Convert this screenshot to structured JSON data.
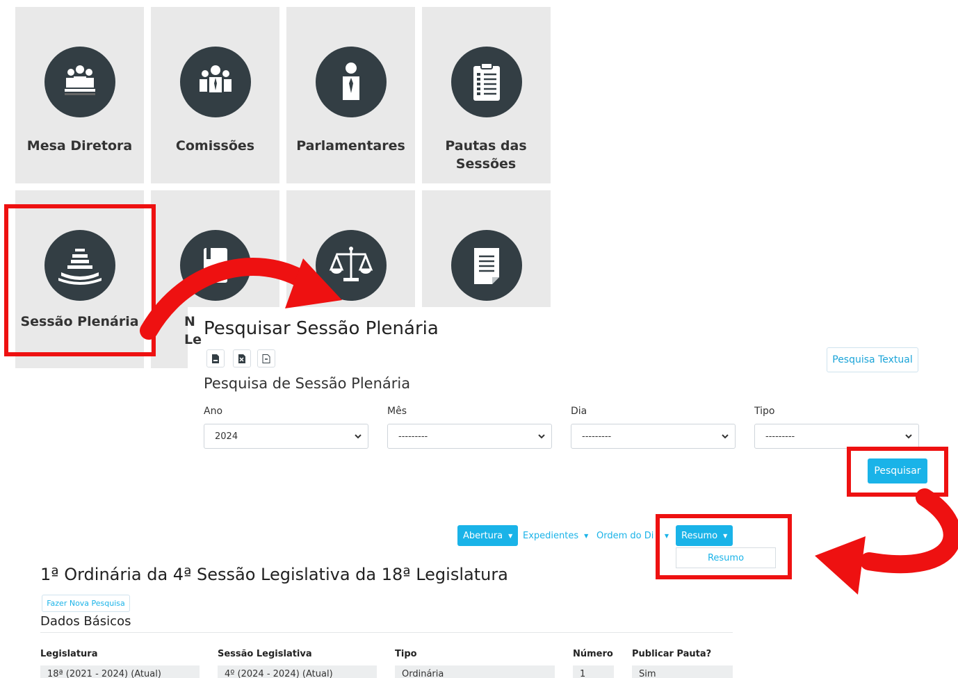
{
  "tiles": {
    "row1": [
      {
        "label": "Mesa Diretora",
        "icon": "board-meeting-icon"
      },
      {
        "label": "Comissões",
        "icon": "group-people-icon"
      },
      {
        "label": "Parlamentares",
        "icon": "person-icon"
      },
      {
        "label": "Pautas das Sessões",
        "icon": "clipboard-checklist-icon"
      }
    ],
    "row2": [
      {
        "label": "Sessão Plenária",
        "icon": "plenary-chamber-icon"
      },
      {
        "label": "Le",
        "icon": "legislation-book-icon"
      },
      {
        "label": "",
        "icon": "scales-of-justice-icon"
      },
      {
        "label": "",
        "icon": "document-icon"
      }
    ],
    "row2_partial_letter": "N"
  },
  "search": {
    "title": "Pesquisar Sessão Plenária",
    "export_icons": [
      "csv-export-icon",
      "xlsx-export-icon",
      "json-export-icon"
    ],
    "textual_button": "Pesquisa Textual",
    "subtitle": "Pesquisa de Sessão Plenária",
    "fields": [
      {
        "label": "Ano",
        "value": "2024"
      },
      {
        "label": "Mês",
        "value": "---------"
      },
      {
        "label": "Dia",
        "value": "---------"
      },
      {
        "label": "Tipo",
        "value": "---------"
      }
    ],
    "submit": "Pesquisar"
  },
  "session_nav": {
    "items": [
      "Abertura",
      "Expedientes",
      "Ordem do Di",
      "Resumo"
    ],
    "dropdown_item": "Resumo"
  },
  "session": {
    "title": "1ª Ordinária da 4ª Sessão Legislativa da 18ª Legislatura",
    "new_search": "Fazer Nova Pesquisa",
    "section": "Dados Básicos",
    "columns": [
      {
        "header": "Legislatura",
        "value": "18ª (2021 - 2024) (Atual)"
      },
      {
        "header": "Sessão Legislativa",
        "value": "4º (2024 - 2024) (Atual)"
      },
      {
        "header": "Tipo",
        "value": "Ordinária"
      },
      {
        "header": "Número",
        "value": "1"
      },
      {
        "header": "Publicar Pauta?",
        "value": "Sim"
      }
    ]
  },
  "colors": {
    "annotation_red": "#ee1111",
    "accent_blue": "#1ab3e8",
    "tile_bg": "#e9e9e9",
    "icon_circle": "#333e44"
  }
}
